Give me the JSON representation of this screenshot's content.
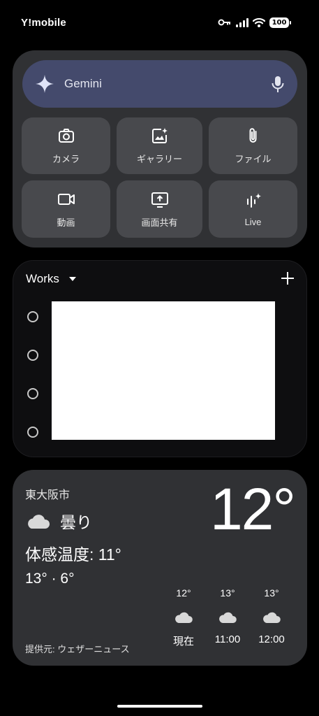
{
  "status_bar": {
    "carrier": "Y!mobile",
    "battery": "100",
    "icons": [
      "key-icon",
      "signal-icon",
      "wifi-icon",
      "battery-icon"
    ]
  },
  "gemini": {
    "label": "Gemini",
    "actions": [
      {
        "label": "カメラ",
        "icon": "camera-icon"
      },
      {
        "label": "ギャラリー",
        "icon": "gallery-icon"
      },
      {
        "label": "ファイル",
        "icon": "paperclip-icon"
      },
      {
        "label": "動画",
        "icon": "video-icon"
      },
      {
        "label": "画面共有",
        "icon": "screen-share-icon"
      },
      {
        "label": "Live",
        "icon": "live-icon"
      }
    ],
    "colors": {
      "card": "#303134",
      "bar": "#444a6c",
      "tile": "#48494d"
    }
  },
  "tasks": {
    "list_name": "Works",
    "item_count_visible": 4
  },
  "weather": {
    "city": "東大阪市",
    "condition": "曇り",
    "feels_like": "体感温度: 11°",
    "hi_lo": "13° · 6°",
    "current_temp": "12°",
    "provider": "提供元: ウェザーニュース",
    "hourly": [
      {
        "temp": "12°",
        "time": "現在",
        "icon": "cloud-icon"
      },
      {
        "temp": "13°",
        "time": "11:00",
        "icon": "cloud-icon"
      },
      {
        "temp": "13°",
        "time": "12:00",
        "icon": "cloud-icon"
      }
    ]
  }
}
